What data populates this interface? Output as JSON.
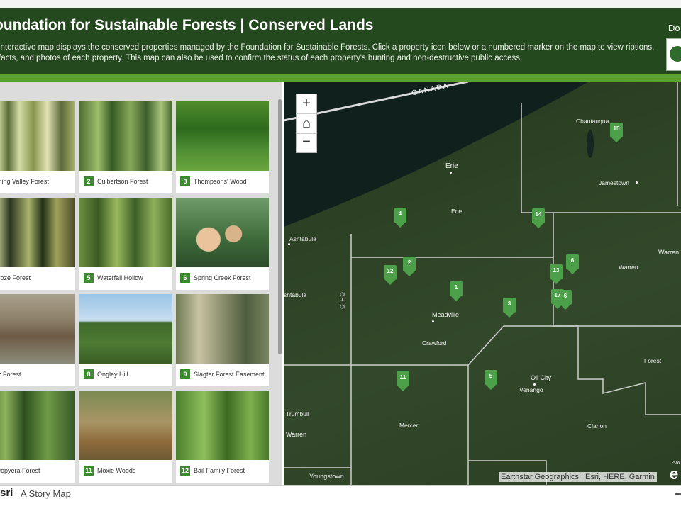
{
  "header": {
    "title": "oundation for Sustainable Forests | Conserved Lands",
    "description": "interactive map displays the conserved properties managed by the Foundation for Sustainable Forests. Click a property icon below or a numbered marker on the map to view riptions, facts, and photos of each property. This map can also be used to confirm the status of each property's hunting and non-destructive public access.",
    "donate": "Do"
  },
  "gallery": {
    "items": [
      {
        "num": "",
        "label": "Blooming Valley Forest"
      },
      {
        "num": "2",
        "label": "Culbertson Forest"
      },
      {
        "num": "3",
        "label": "Thompsons' Wood"
      },
      {
        "num": "",
        "label": "Floraroze Forest"
      },
      {
        "num": "5",
        "label": "Waterfall Hollow"
      },
      {
        "num": "6",
        "label": "Spring Creek Forest"
      },
      {
        "num": "",
        "label": "Savitz Forest"
      },
      {
        "num": "8",
        "label": "Ongley Hill"
      },
      {
        "num": "9",
        "label": "Slagter Forest Easement"
      },
      {
        "num": "",
        "label": "Lay-Dopyera Forest"
      },
      {
        "num": "11",
        "label": "Moxie Woods"
      },
      {
        "num": "12",
        "label": "Bail Family Forest"
      }
    ]
  },
  "map": {
    "zoom_in": "+",
    "home": "⌂",
    "zoom_out": "−",
    "labels": {
      "canada": "CANADA",
      "chautauqua": "Chautauqua",
      "erie_city": "Erie",
      "erie_county": "Erie",
      "jamestown": "Jamestown",
      "ashtabula_city": "Ashtabula",
      "ashtabula_county": "shtabula",
      "ohio": "OHIO",
      "warren_city": "Warren",
      "warren_county": "Warren",
      "meadville": "Meadville",
      "crawford": "Crawford",
      "oil_city": "Oil City",
      "venango": "Venango",
      "forest": "Forest",
      "mercer": "Mercer",
      "clarion": "Clarion",
      "trumbull": "Trumbull",
      "warren_oh": "Warren",
      "youngstown": "Youngstown"
    },
    "markers": [
      "15",
      "4",
      "14",
      "12",
      "2",
      "6",
      "13",
      "1",
      "3",
      "17",
      "6",
      "11",
      "5"
    ],
    "attribution": "Earthstar Geographics | Esri, HERE, Garmin",
    "esri_logo": "e",
    "powered": "POW"
  },
  "footer": {
    "esri": "sri",
    "story": "A Story Map"
  }
}
